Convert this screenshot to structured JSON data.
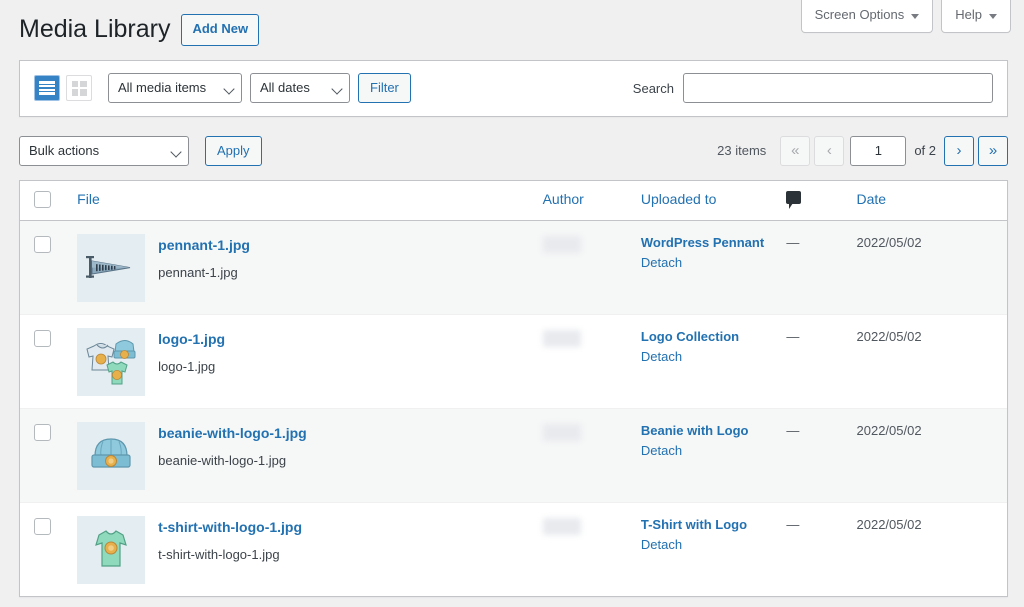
{
  "screen_meta": {
    "screen_options_label": "Screen Options",
    "help_label": "Help"
  },
  "header": {
    "title": "Media Library",
    "add_new_label": "Add New"
  },
  "filter_bar": {
    "list_view_icon": "list-view-icon",
    "grid_view_icon": "grid-view-icon",
    "media_type_selected": "All media items",
    "media_type_options": [
      "All media items"
    ],
    "date_selected": "All dates",
    "date_options": [
      "All dates"
    ],
    "filter_button_label": "Filter",
    "search_label": "Search",
    "search_value": "",
    "search_placeholder": ""
  },
  "tablenav": {
    "bulk_actions_selected": "Bulk actions",
    "bulk_actions_options": [
      "Bulk actions"
    ],
    "apply_label": "Apply",
    "items_count": "23 items",
    "first_page_label": "«",
    "prev_page_label": "‹",
    "current_page": "1",
    "of_total_label": "of 2",
    "next_page_label": "›",
    "last_page_label": "»"
  },
  "table": {
    "columns": {
      "file": "File",
      "author": "Author",
      "uploaded_to": "Uploaded to",
      "comments_icon": "comment-bubble-icon",
      "date": "Date"
    },
    "rows": [
      {
        "thumb": "pennant-thumbnail",
        "title": "pennant-1.jpg",
        "filename": "pennant-1.jpg",
        "author": "",
        "uploaded_to": "WordPress Pennant",
        "detach_label": "Detach",
        "comments": "—",
        "date": "2022/05/02"
      },
      {
        "thumb": "logo-collection-thumbnail",
        "title": "logo-1.jpg",
        "filename": "logo-1.jpg",
        "author": "",
        "uploaded_to": "Logo Collection",
        "detach_label": "Detach",
        "comments": "—",
        "date": "2022/05/02"
      },
      {
        "thumb": "beanie-thumbnail",
        "title": "beanie-with-logo-1.jpg",
        "filename": "beanie-with-logo-1.jpg",
        "author": "",
        "uploaded_to": "Beanie with Logo",
        "detach_label": "Detach",
        "comments": "—",
        "date": "2022/05/02"
      },
      {
        "thumb": "t-shirt-thumbnail",
        "title": "t-shirt-with-logo-1.jpg",
        "filename": "t-shirt-with-logo-1.jpg",
        "author": "",
        "uploaded_to": "T-Shirt with Logo",
        "detach_label": "Detach",
        "comments": "—",
        "date": "2022/05/02"
      }
    ]
  },
  "colors": {
    "page_background": "#f0f0f1",
    "link_blue": "#2271b1",
    "active_view_blue": "#3582c4",
    "text_dark": "#3c434a",
    "border_gray": "#c3c4c7",
    "row_alt": "#f6f7f7",
    "thumb_background": "#e4edf1"
  }
}
